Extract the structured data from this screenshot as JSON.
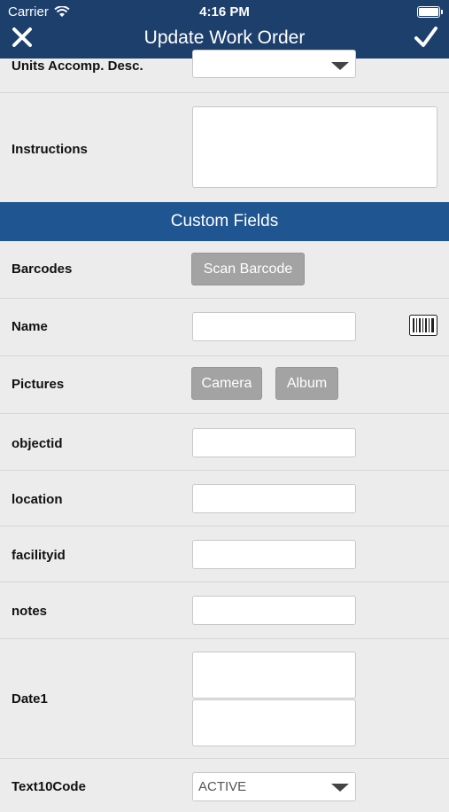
{
  "status": {
    "carrier": "Carrier",
    "time": "4:16 PM"
  },
  "nav": {
    "title": "Update Work Order"
  },
  "fields": {
    "units_accomp_desc": "Units Accomp. Desc.",
    "instructions": "Instructions"
  },
  "section": {
    "title": "Custom Fields"
  },
  "custom": {
    "barcodes": "Barcodes",
    "scan_barcode": "Scan Barcode",
    "name": "Name",
    "pictures": "Pictures",
    "camera": "Camera",
    "album": "Album",
    "objectid": "objectid",
    "location": "location",
    "facilityid": "facilityid",
    "notes": "notes",
    "date1": "Date1",
    "text10code": "Text10Code",
    "text10code_value": "ACTIVE"
  },
  "colors": {
    "header": "#1c3f6c",
    "section": "#1f5590",
    "button": "#a3a3a3"
  },
  "icons": [
    "wifi-icon",
    "battery-icon",
    "close-icon",
    "checkmark-icon",
    "barcode-icon",
    "dropdown-arrow-icon"
  ]
}
